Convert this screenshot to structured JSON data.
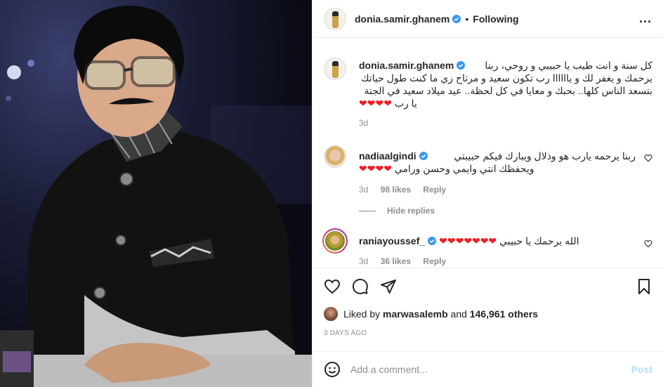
{
  "header": {
    "username": "donia.samir.ghanem",
    "separator": "•",
    "follow_status": "Following",
    "more": "..."
  },
  "caption": {
    "username": "donia.samir.ghanem",
    "lines": [
      "كل سنة و انت طيب يا حبيبي و روحي، ربنا",
      "يرحمك و يغفر لك و ياااااا رب تكون سعيد و مرتاح زي ما كنت طول حياتك",
      "بتسعد الناس كلها.. بحبك و معايا في كل لحظة.. عيد ميلاد سعيد في الجنة",
      "يا رب ❤❤❤❤"
    ],
    "time": "3d"
  },
  "comments": [
    {
      "username": "nadiaalgindi",
      "lines": [
        "ربنا يرحمه يارب هو وذلال ويبارك فيكم حبيبتي",
        "ويحفظك انتي وايمي وحسن ورامي ❤❤❤❤"
      ],
      "time": "3d",
      "likes": "98 likes",
      "reply": "Reply"
    },
    {
      "username": "raniayoussef_",
      "text": "الله يرحمك يا حبيبي ❤❤❤❤❤❤❤",
      "time": "3d",
      "likes": "36 likes",
      "reply": "Reply"
    }
  ],
  "hide_replies": "Hide replies",
  "likes_bar": {
    "prefix": "Liked by",
    "user": "marwasalemb",
    "middle": "and",
    "count": "146,961 others"
  },
  "posted_ago": "3 DAYS AGO",
  "add_comment": {
    "placeholder": "Add a comment...",
    "post": "Post"
  },
  "colors": {
    "verified": "#3897f0",
    "heart": "#ed1c24",
    "post_disabled": "#b2dffc",
    "muted": "#8e8e8e"
  },
  "icons": {
    "like": "heart-icon",
    "comment": "comment-icon",
    "share": "share-icon",
    "save": "bookmark-icon",
    "emoji": "emoji-icon"
  }
}
